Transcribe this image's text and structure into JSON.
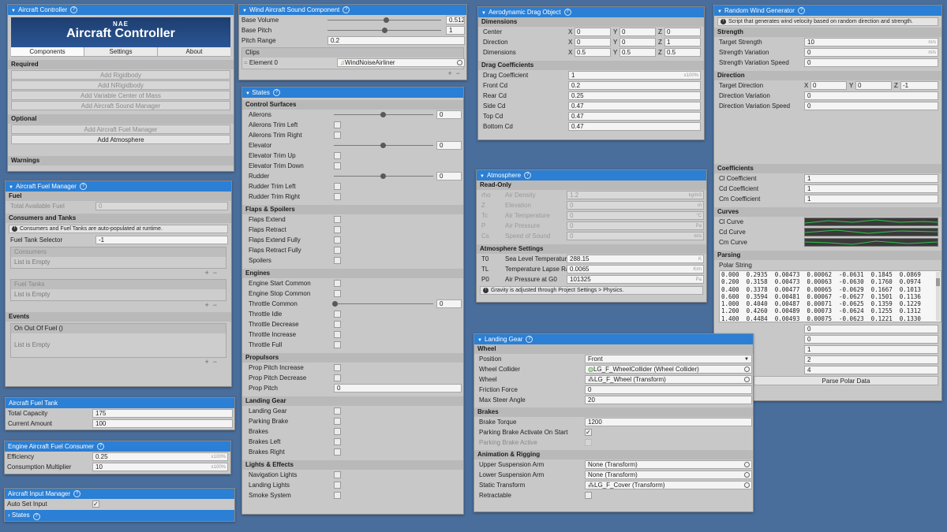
{
  "controller": {
    "title": "Aircraft Controller",
    "banner_small": "NAE",
    "banner_big": "Aircraft Controller",
    "tabs": [
      "Components",
      "Settings",
      "About"
    ],
    "required_label": "Required",
    "required_buttons": [
      "Add Rigidbody",
      "Add NRigidbody",
      "Add Variable Center of Mass",
      "Add Aircraft Sound Manager"
    ],
    "optional_label": "Optional",
    "optional_buttons": [
      "Add Aircraft Fuel Manager",
      "Add Atmosphere"
    ],
    "warnings_label": "Warnings"
  },
  "fuel_manager": {
    "title": "Aircraft Fuel Manager",
    "fuel_label": "Fuel",
    "total_label": "Total Available Fuel",
    "total_value": "0",
    "ct_label": "Consumers and Tanks",
    "note": "Consumers and Fuel Tanks are auto-populated at runtime.",
    "selector_label": "Fuel Tank Selector",
    "selector_value": "-1",
    "consumers_label": "Consumers",
    "empty": "List is Empty",
    "tanks_label": "Fuel Tanks",
    "events_label": "Events",
    "event_name": "On Out Of Fuel ()"
  },
  "fuel_tank": {
    "title": "Aircraft Fuel Tank",
    "cap_label": "Total Capacity",
    "cap_value": "175",
    "cur_label": "Current Amount",
    "cur_value": "100"
  },
  "consumer": {
    "title": "Engine Aircraft Fuel Consumer",
    "eff_label": "Efficiency",
    "eff_value": "0.25",
    "eff_unit": "x100%",
    "mul_label": "Consumption Multiplier",
    "mul_value": "10",
    "mul_unit": "x100%"
  },
  "input_mgr": {
    "title": "Aircraft Input Manager",
    "auto_label": "Auto Set Input",
    "states_label": "States"
  },
  "sound": {
    "title": "Wind Aircraft Sound Component",
    "vol_label": "Base Volume",
    "vol_value": "0.512",
    "vol_level": 0.512,
    "pitch_label": "Base Pitch",
    "pitch_value": "1",
    "pitch_level": 0.5,
    "range_label": "Pitch Range",
    "range_value": "0.2",
    "clips_label": "Clips",
    "elem_label": "Element 0",
    "elem_value": "WindNoiseAirliner"
  },
  "states": {
    "title": "States",
    "sections": [
      {
        "name": "Control Surfaces",
        "rows": [
          {
            "l": "Ailerons",
            "t": "slider",
            "v": "0"
          },
          {
            "l": "Ailerons Trim Left",
            "t": "cb"
          },
          {
            "l": "Ailerons Trim Right",
            "t": "cb"
          },
          {
            "l": "Elevator",
            "t": "slider",
            "v": "0"
          },
          {
            "l": "Elevator Trim Up",
            "t": "cb"
          },
          {
            "l": "Elevator Trim Down",
            "t": "cb"
          },
          {
            "l": "Rudder",
            "t": "slider",
            "v": "0"
          },
          {
            "l": "Rudder Trim Left",
            "t": "cb"
          },
          {
            "l": "Rudder Trim Right",
            "t": "cb"
          }
        ]
      },
      {
        "name": "Flaps & Spoilers",
        "rows": [
          {
            "l": "Flaps Extend",
            "t": "cb"
          },
          {
            "l": "Flaps Retract",
            "t": "cb"
          },
          {
            "l": "Flaps Extend Fully",
            "t": "cb"
          },
          {
            "l": "Flaps Retract Fully",
            "t": "cb"
          },
          {
            "l": "Spoilers",
            "t": "cb"
          }
        ]
      },
      {
        "name": "Engines",
        "rows": [
          {
            "l": "Engine Start Common",
            "t": "cb"
          },
          {
            "l": "Engine Stop Common",
            "t": "cb"
          },
          {
            "l": "Throttle Common",
            "t": "slider0",
            "v": "0"
          },
          {
            "l": "Throttle Idle",
            "t": "cb"
          },
          {
            "l": "Throttle Decrease",
            "t": "cb"
          },
          {
            "l": "Throttle Increase",
            "t": "cb"
          },
          {
            "l": "Throttle Full",
            "t": "cb"
          }
        ]
      },
      {
        "name": "Propulsors",
        "rows": [
          {
            "l": "Prop Pitch Increase",
            "t": "cb"
          },
          {
            "l": "Prop Pitch Decrease",
            "t": "cb"
          },
          {
            "l": "Prop Pitch",
            "t": "field",
            "v": "0"
          }
        ]
      },
      {
        "name": "Landing Gear",
        "rows": [
          {
            "l": "Landing Gear",
            "t": "cb"
          },
          {
            "l": "Parking Brake",
            "t": "cb"
          },
          {
            "l": "Brakes",
            "t": "cb"
          },
          {
            "l": "Brakes Left",
            "t": "cb"
          },
          {
            "l": "Brakes Right",
            "t": "cb"
          }
        ]
      },
      {
        "name": "Lights & Effects",
        "rows": [
          {
            "l": "Navigation Lights",
            "t": "cb"
          },
          {
            "l": "Landing Lights",
            "t": "cb"
          },
          {
            "l": "Smoke System",
            "t": "cb"
          }
        ]
      }
    ]
  },
  "drag": {
    "title": "Aerodynamic Drag Object",
    "dims_label": "Dimensions",
    "vec_rows": [
      {
        "l": "Center",
        "x": "0",
        "y": "0",
        "z": "0"
      },
      {
        "l": "Direction",
        "x": "0",
        "y": "0",
        "z": "1"
      },
      {
        "l": "Dimensions",
        "x": "0.5",
        "y": "0.5",
        "z": "0.5"
      }
    ],
    "coef_label": "Drag Coefficients",
    "coef_rows": [
      {
        "l": "Drag Coefficient",
        "v": "1",
        "u": "x100%"
      },
      {
        "l": "Front Cd",
        "v": "0.2"
      },
      {
        "l": "Rear Cd",
        "v": "0.25"
      },
      {
        "l": "Side Cd",
        "v": "0.47"
      },
      {
        "l": "Top Cd",
        "v": "0.47"
      },
      {
        "l": "Bottom Cd",
        "v": "0.47"
      }
    ]
  },
  "atmo": {
    "title": "Atmosphere",
    "ro_label": "Read-Only",
    "ro_rows": [
      {
        "s": "rho",
        "l": "Air Density",
        "v": "1.2",
        "u": "kg/m3"
      },
      {
        "s": "Z",
        "l": "Elevation",
        "v": "0",
        "u": "m"
      },
      {
        "s": "Tc",
        "l": "Air Temperature",
        "v": "0",
        "u": "°C"
      },
      {
        "s": "P",
        "l": "Air Pressure",
        "v": "0",
        "u": "Pa"
      },
      {
        "s": "Cs",
        "l": "Speed of Sound",
        "v": "0",
        "u": "m/s"
      }
    ],
    "set_label": "Atmosphere Settings",
    "set_rows": [
      {
        "s": "T0",
        "l": "Sea Level Temperatur",
        "v": "288.15",
        "u": "K"
      },
      {
        "s": "TL",
        "l": "Temperature Lapse Ra",
        "v": "0.0065",
        "u": "K/m"
      },
      {
        "s": "P0",
        "l": "Air Pressure at G0",
        "v": "101325",
        "u": "Pa"
      }
    ],
    "note": "Gravity is adjusted through Project Settings > Physics."
  },
  "gear": {
    "title": "Landing Gear",
    "wheel_label": "Wheel",
    "pos_label": "Position",
    "pos_value": "Front",
    "wc_label": "Wheel Collider",
    "wc_value": "LG_F_WheelCollider (Wheel Collider)",
    "w_label": "Wheel",
    "w_value": "LG_F_Wheel (Transform)",
    "ff_label": "Friction Force",
    "ff_value": "0",
    "ms_label": "Max Steer Angle",
    "ms_value": "20",
    "brakes_label": "Brakes",
    "bt_label": "Brake Torque",
    "bt_value": "1200",
    "pba_label": "Parking Brake Activate On Start",
    "pbact_label": "Parking Brake Active",
    "anim_label": "Animation & Rigging",
    "usa_label": "Upper Suspension Arm",
    "usa_value": "None (Transform)",
    "lsa_label": "Lower Suspension Arm",
    "lsa_value": "None (Transform)",
    "st_label": "Static Transform",
    "st_value": "LG_F_Cover (Transform)",
    "retr_label": "Retractable"
  },
  "wind": {
    "title": "Random Wind Generator",
    "note": "Script that generates wind velocity based on random direction and strength.",
    "strength_label": "Strength",
    "s_rows": [
      {
        "l": "Target Strength",
        "v": "10",
        "u": "m/s"
      },
      {
        "l": "Strength Variation",
        "v": "0",
        "u": "m/s"
      },
      {
        "l": "Strength Variation Speed",
        "v": "0"
      }
    ],
    "dir_label": "Direction",
    "td_label": "Target Direction",
    "td_x": "0",
    "td_y": "0",
    "td_z": "-1",
    "d_rows": [
      {
        "l": "Direction Variation",
        "v": "0"
      },
      {
        "l": "Direction Variation Speed",
        "v": "0"
      }
    ],
    "coef_label": "Coefficients",
    "c_rows": [
      {
        "l": "Cl Coefficient",
        "v": "1"
      },
      {
        "l": "Cd Coefficient",
        "v": "1"
      },
      {
        "l": "Cm Coefficient",
        "v": "1"
      }
    ],
    "curves_label": "Curves",
    "curves": [
      "Cl Curve",
      "Cd Curve",
      "Cm Curve"
    ],
    "parsing_label": "Parsing",
    "polar_label": "Polar String",
    "polar_lines": [
      "0.000  0.2935  0.00473  0.00062  -0.0631  0.1845  0.0869",
      "0.200  0.3158  0.00473  0.00063  -0.0630  0.1760  0.0974",
      "0.400  0.3378  0.00477  0.00065  -0.0629  0.1667  0.1013",
      "0.600  0.3594  0.00481  0.00067  -0.0627  0.1501  0.1136",
      "1.000  0.4040  0.00487  0.00071  -0.0625  0.1359  0.1229",
      "1.200  0.4260  0.00489  0.00073  -0.0624  0.1255  0.1312",
      "1.400  0.4484  0.00493  0.00075  -0.0623  0.1221  0.1330"
    ],
    "idx_values": [
      "0",
      "0",
      "1",
      "2",
      "4"
    ],
    "parse_btn": "Parse Polar Data"
  }
}
